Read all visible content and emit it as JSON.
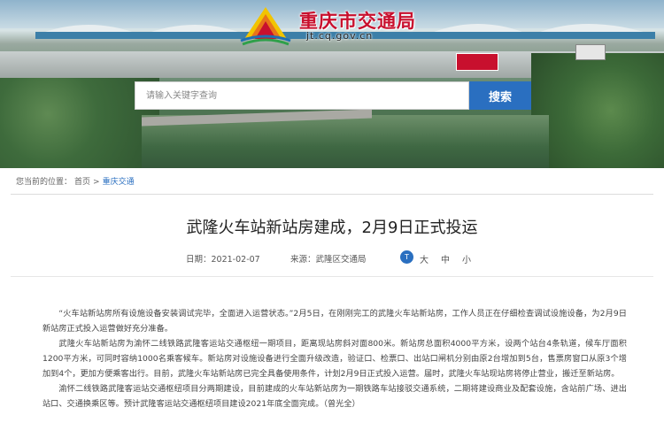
{
  "site": {
    "title": "重庆市交通局",
    "url": "jt.cq.gov.cn"
  },
  "search": {
    "placeholder": "请输入关键字查询",
    "button_label": "搜索"
  },
  "breadcrumb": {
    "prefix": "您当前的位置：",
    "items": [
      "首页",
      "重庆交通"
    ],
    "separator": ">"
  },
  "article": {
    "title": "武隆火车站新站房建成，2月9日正式投运",
    "date": "日期：2021-02-07",
    "source": "来源：武隆区交通局",
    "font_sizes": [
      "大",
      "中",
      "小"
    ],
    "paragraphs": [
      "“火车站新站房所有设施设备安装调试完毕，全面进入运营状态。”2月5日，在刚刚完工的武隆火车站新站房，工作人员正在仔细检查调试设施设备，为2月9日新站房正式投入运营做好充分准备。",
      "武隆火车站新站房为渝怀二线铁路武隆客运站交通枢纽一期项目，距离现站房斜对面800米。新站房总面积4000平方米，设两个站台4条轨道，候车厅面积1200平方米，可同时容纳1000名乘客候车。新站房对设施设备进行全面升级改造，验证口、检票口、出站口闸机分别由原2台增加到5台，售票房窗口从原3个增加到4个，更加方便乘客出行。目前，武隆火车站新站房已完全具备使用条件，计划2月9日正式投入运营。届时，武隆火车站现站房将停止营业，搬迁至新站房。",
      "渝怀二线铁路武隆客运站交通枢纽项目分两期建设，目前建成的火车站新站房为一期铁路车站接驳交通系统，二期将建设商业及配套设施，含站前广场、进出站口、交通换乘区等。预计武隆客运站交通枢纽项目建设2021年底全面完成。（曾光全）"
    ]
  },
  "colors": {
    "brand_red": "#c8102e",
    "accent_blue": "#2a6fc0"
  }
}
